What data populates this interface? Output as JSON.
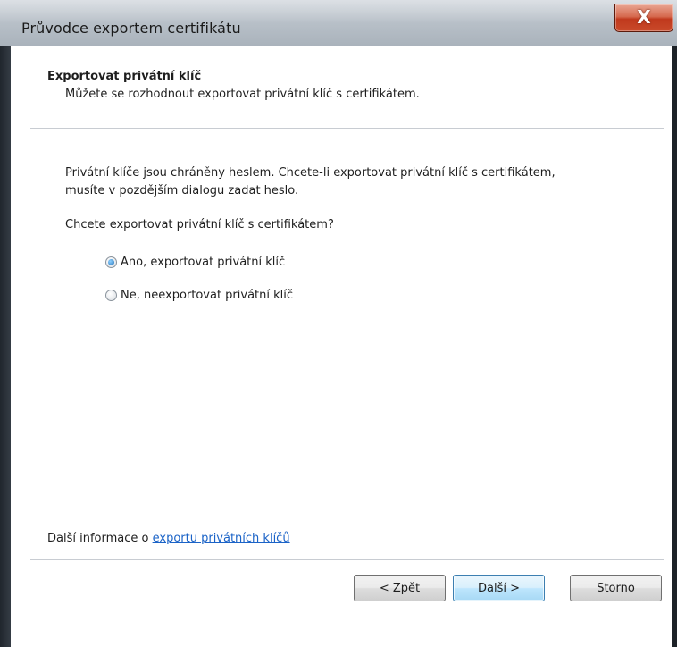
{
  "window": {
    "title": "Průvodce exportem certifikátu",
    "close_glyph": "X"
  },
  "header": {
    "title": "Exportovat privátní klíč",
    "subtitle": "Můžete se rozhodnout exportovat privátní klíč s certifikátem."
  },
  "body": {
    "description_line1": "Privátní klíče jsou chráněny heslem. Chcete-li exportovat privátní klíč s certifikátem,",
    "description_line2": "musíte v pozdějším dialogu zadat heslo.",
    "question": "Chcete exportovat privátní klíč s certifikátem?",
    "options": [
      {
        "label": "Ano, exportovat privátní klíč",
        "selected": true
      },
      {
        "label": "Ne, neexportovat privátní klíč",
        "selected": false
      }
    ]
  },
  "footer": {
    "info_prefix": "Další informace o ",
    "info_link": "exportu privátních klíčů",
    "back_label": "< Zpět",
    "next_label": "Další >",
    "cancel_label": "Storno"
  },
  "colors": {
    "link": "#1b63c7",
    "radio_selected": "#1f6fb5",
    "close_button": "#c0391d"
  },
  "icons": {
    "close": "close-icon",
    "radio_selected": "radio-selected-icon",
    "radio_unselected": "radio-unselected-icon"
  }
}
